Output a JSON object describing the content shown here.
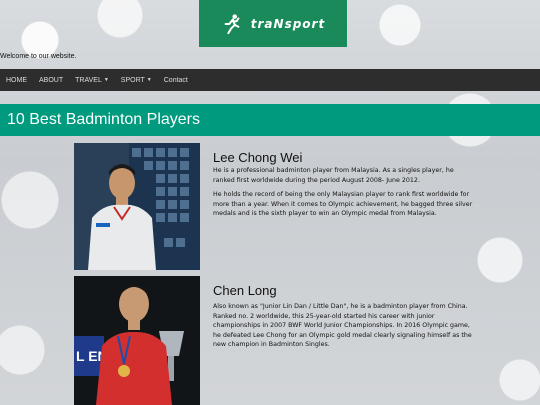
{
  "logo": {
    "text": "traNsport",
    "icon": "runner-icon",
    "bg": "#1b8a5a"
  },
  "welcome": "Welcome to our website.",
  "nav": [
    {
      "label": "HOME",
      "dropdown": false
    },
    {
      "label": "ABOUT",
      "dropdown": false
    },
    {
      "label": "TRAVEL",
      "dropdown": true
    },
    {
      "label": "SPORT",
      "dropdown": true
    },
    {
      "label": "Contact",
      "dropdown": false
    }
  ],
  "banner": {
    "title": "10 Best Badminton Players",
    "bg": "#009a7e"
  },
  "players": [
    {
      "name": "Lee Chong Wei",
      "paragraphs": [
        "He is a professional badminton player from Malaysia. As a singles player, he ranked first worldwide during the period August 2008- June 2012.",
        "He holds the record of being the only Malaysian player to rank first worldwide for more than a year. When it comes to Olympic achievement, he bagged three silver medals and is the sixth player to win an Olympic medal from Malaysia."
      ]
    },
    {
      "name": "Chen Long",
      "paragraphs": [
        "Also known as \"Junior Lin Dan / Little Dan\", he is a badminton player from China. Ranked no. 2 worldwide, this 25-year-old started his career with junior championships in 2007 BWF World Junior Championships. In 2016 Olympic game, he defeated Lee Chong for an Olympic gold medal clearly signaling himself as the new champion in Badminton Singles."
      ]
    }
  ]
}
